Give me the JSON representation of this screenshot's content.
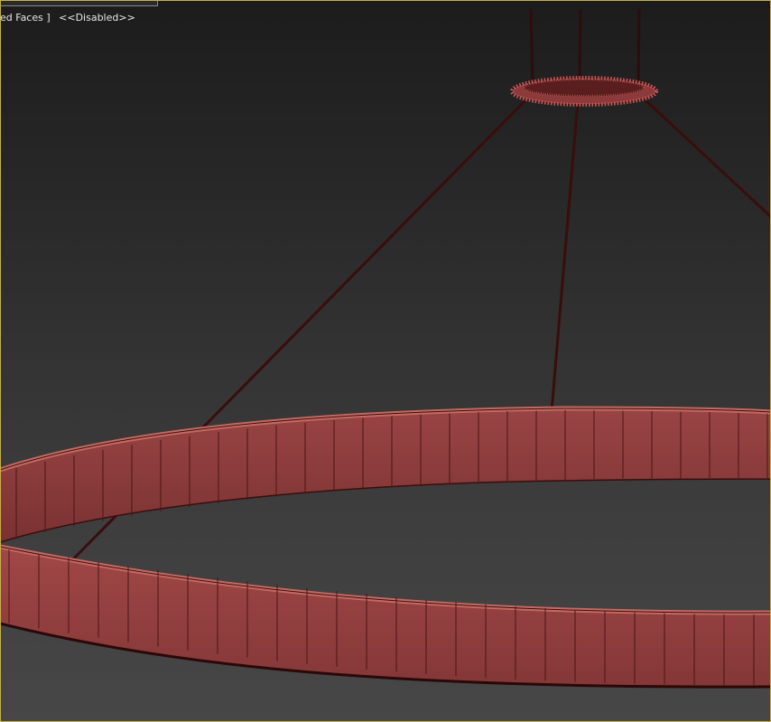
{
  "viewport": {
    "labels": {
      "shading_mode": "ed Faces ]",
      "status": "<<Disabled>>"
    },
    "colors": {
      "frame": "#c7b04a",
      "ring_fill": "#8a3a3a",
      "ring_top": "#b9544c",
      "wire": "#3a0d0d"
    },
    "scene_objects": [
      "ceiling-canopy-ring",
      "suspension-cables",
      "led-ring-light"
    ]
  }
}
